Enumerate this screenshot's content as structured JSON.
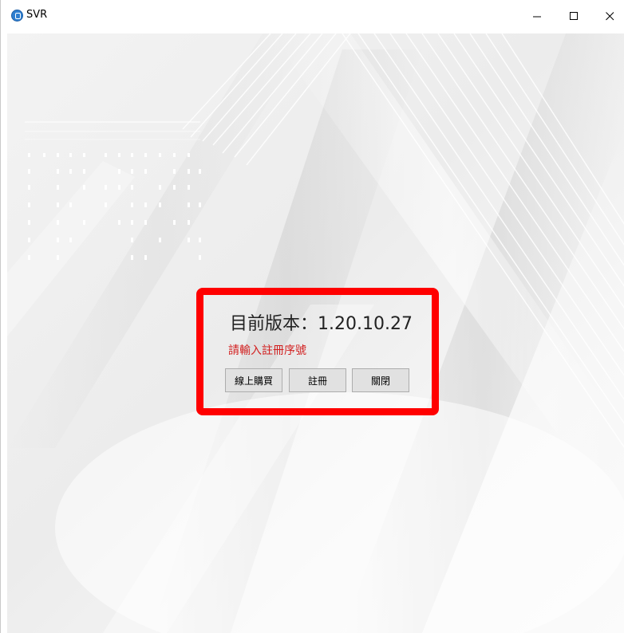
{
  "window": {
    "title": "SVR",
    "controls": {
      "minimize_icon": "minimize-icon",
      "maximize_icon": "maximize-icon",
      "close_icon": "close-icon"
    }
  },
  "dialog": {
    "version_text": "目前版本：1.20.10.27",
    "prompt_text": "請輸入註冊序號",
    "prompt_color": "#d21f1f",
    "highlight_color": "#ff0000",
    "buttons": {
      "buy_online": "線上購買",
      "register": "註冊",
      "close": "關閉"
    }
  }
}
